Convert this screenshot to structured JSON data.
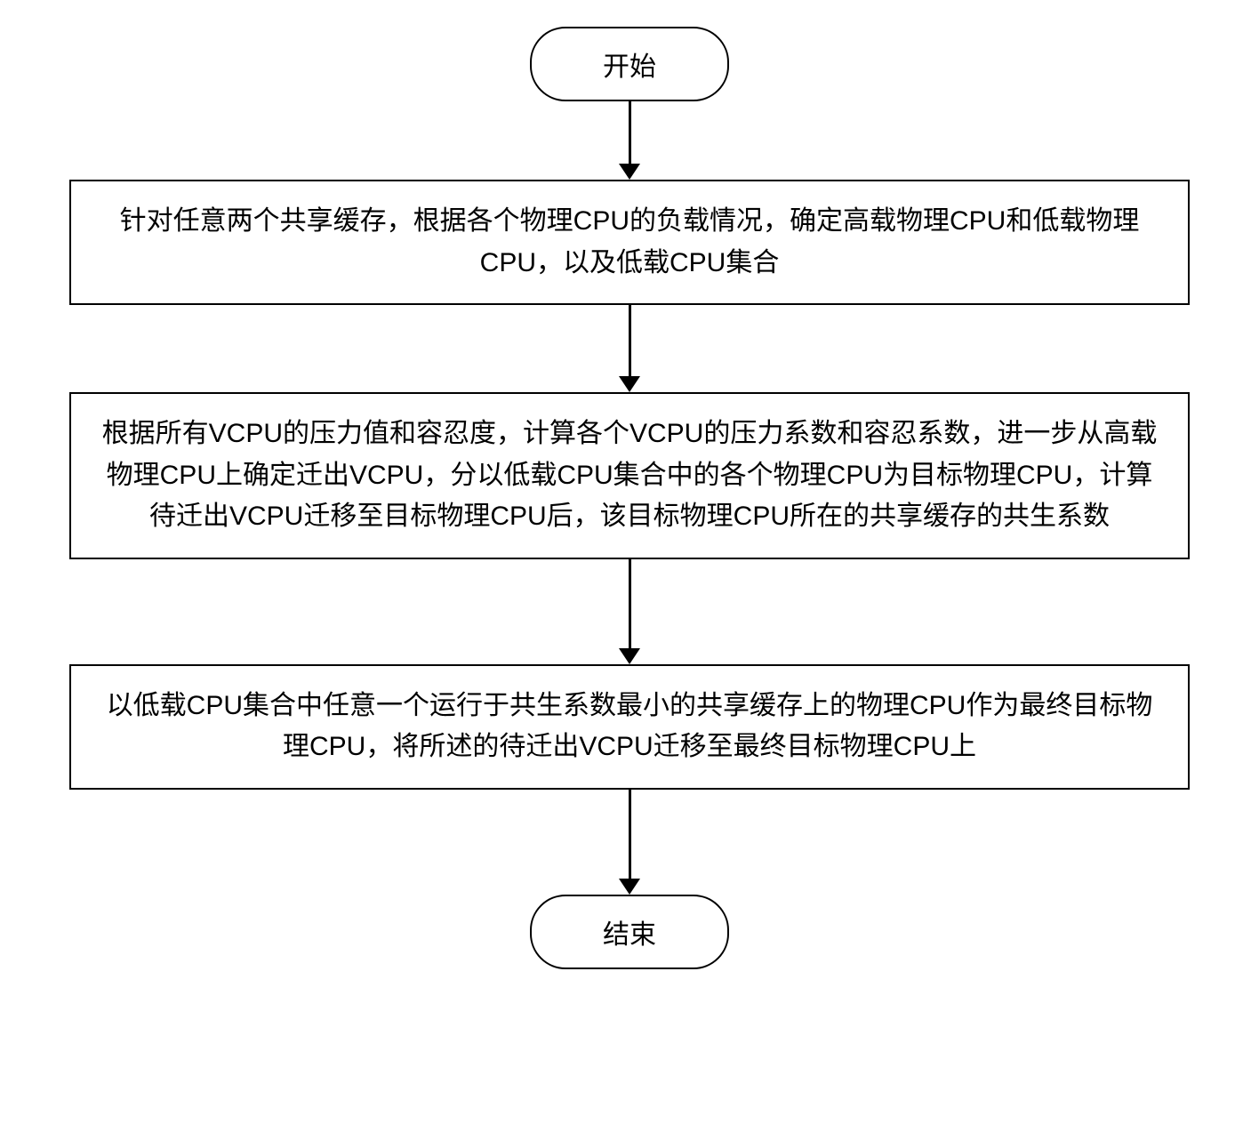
{
  "flow": {
    "start": "开始",
    "step1": "针对任意两个共享缓存，根据各个物理CPU的负载情况，确定高载物理CPU和低载物理CPU，以及低载CPU集合",
    "step2": "根据所有VCPU的压力值和容忍度，计算各个VCPU的压力系数和容忍系数，进一步从高载物理CPU上确定迁出VCPU，分以低载CPU集合中的各个物理CPU为目标物理CPU，计算待迁出VCPU迁移至目标物理CPU后，该目标物理CPU所在的共享缓存的共生系数",
    "step3": "以低载CPU集合中任意一个运行于共生系数最小的共享缓存上的物理CPU作为最终目标物理CPU，将所述的待迁出VCPU迁移至最终目标物理CPU上",
    "end": "结束"
  }
}
